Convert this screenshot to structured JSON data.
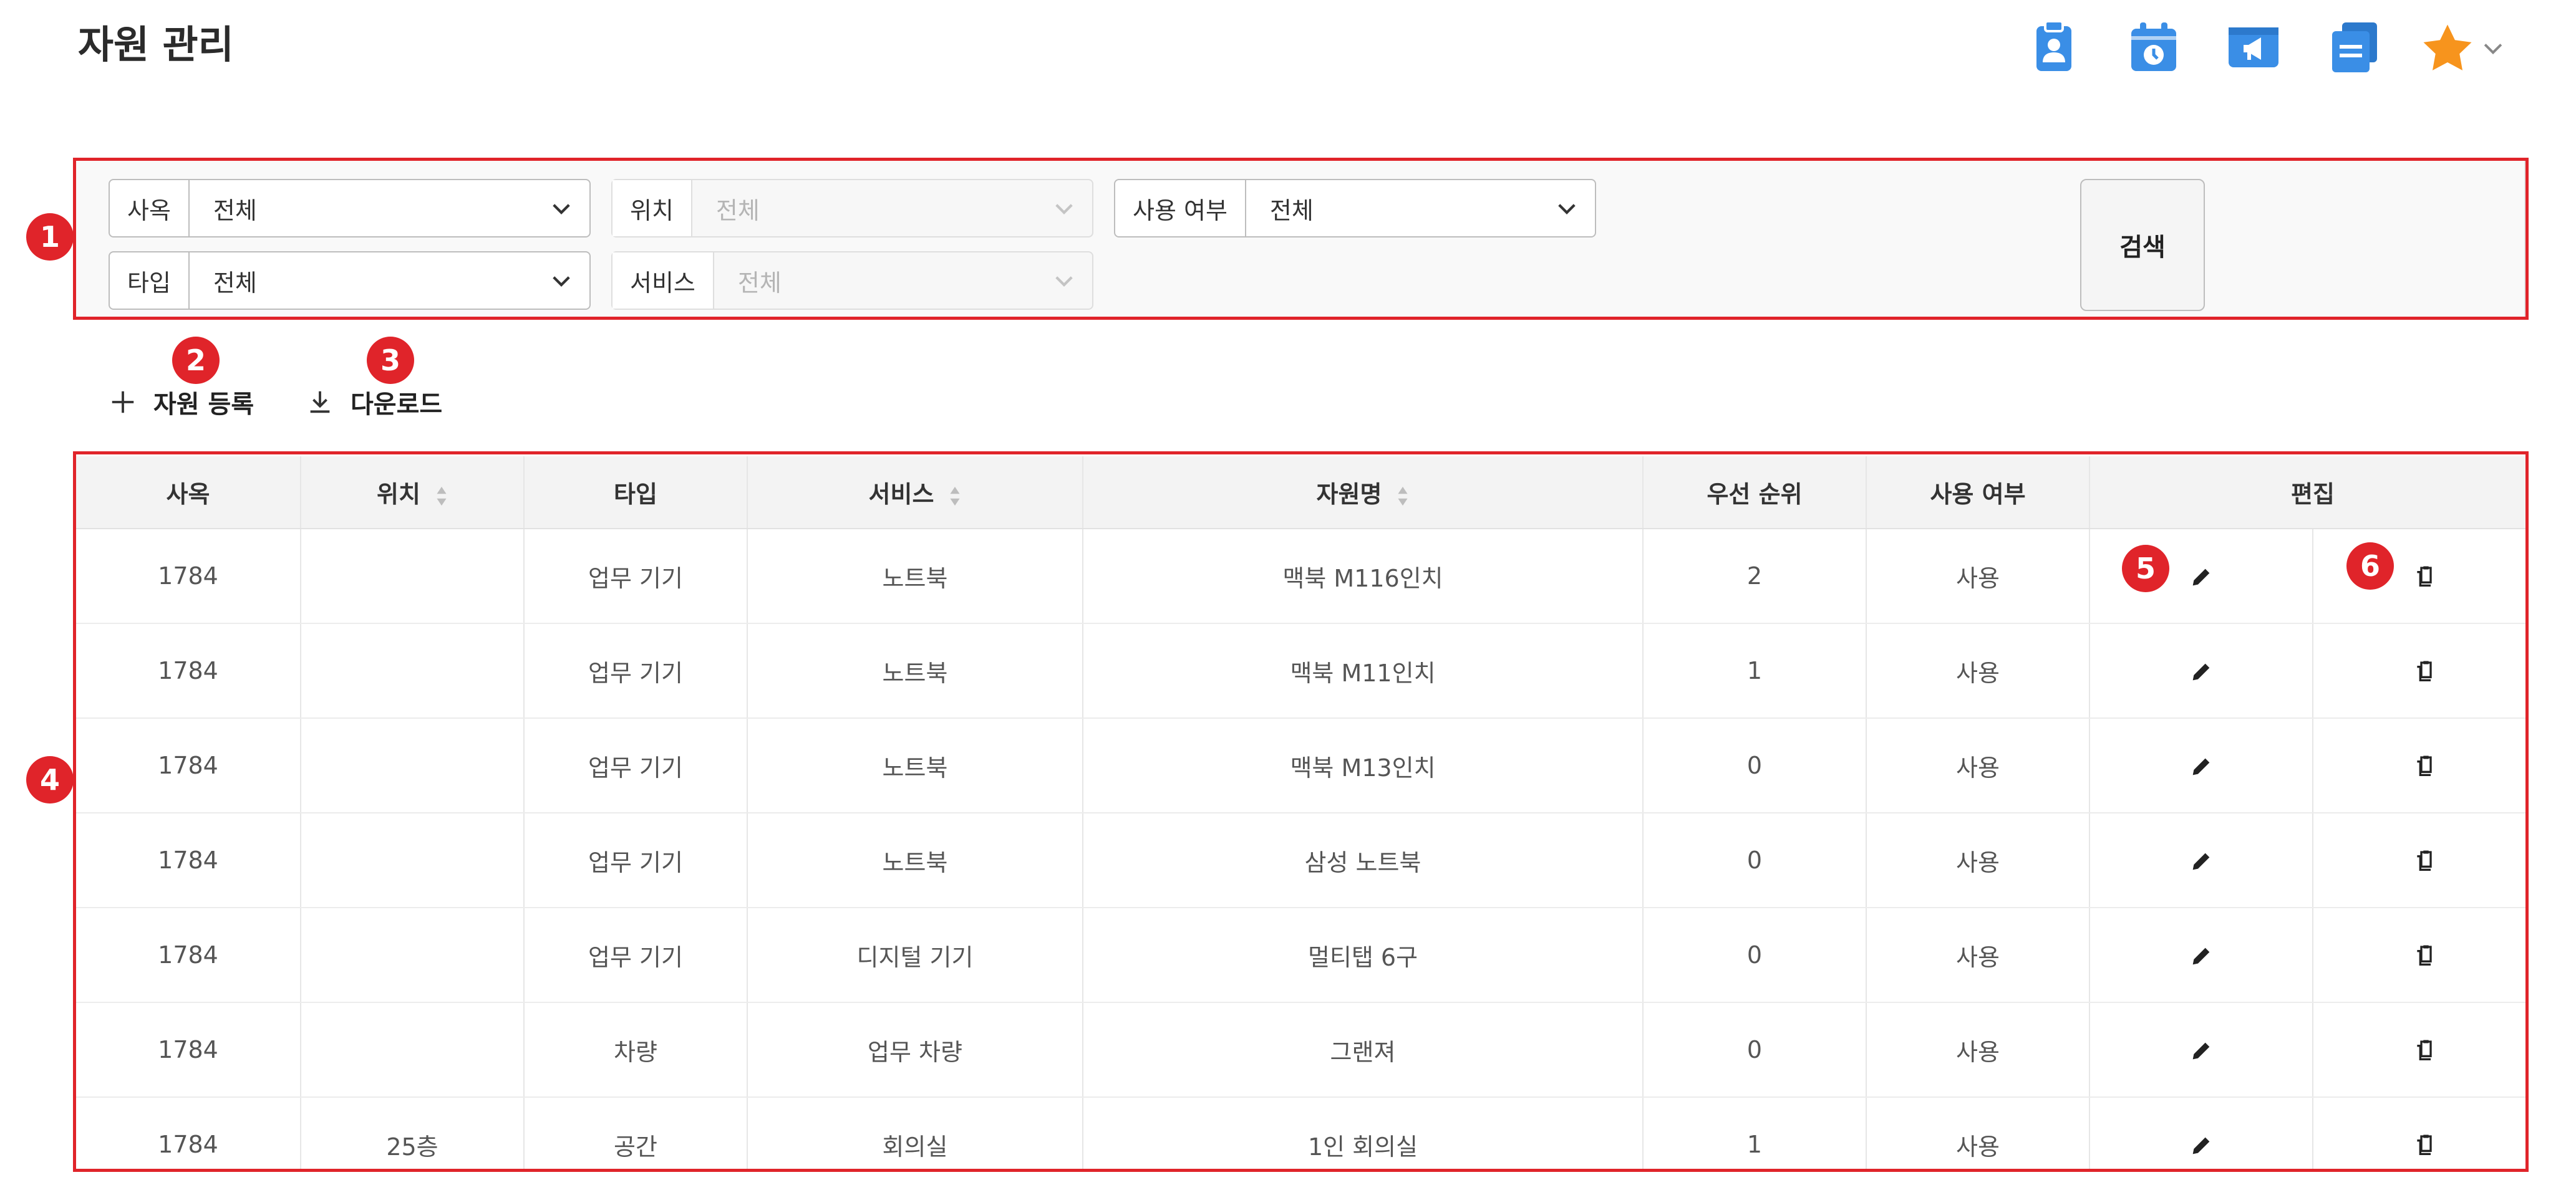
{
  "page": {
    "title": "자원 관리"
  },
  "header_icons": [
    "clipboard-user-icon",
    "calendar-clock-icon",
    "megaphone-window-icon",
    "stacked-documents-icon",
    "favorite-star-icon"
  ],
  "colors": {
    "icon_blue": "#3a8ee6",
    "star": "#f7941d",
    "callout_red": "#e0242a"
  },
  "filters": {
    "building": {
      "label": "사옥",
      "value": "전체"
    },
    "location": {
      "label": "위치",
      "value": "전체"
    },
    "usage": {
      "label": "사용 여부",
      "value": "전체"
    },
    "type": {
      "label": "타입",
      "value": "전체"
    },
    "service": {
      "label": "서비스",
      "value": "전체"
    },
    "search_label": "검색"
  },
  "actions": {
    "register_label": "자원 등록",
    "download_label": "다운로드"
  },
  "callouts": [
    "1",
    "2",
    "3",
    "4",
    "5",
    "6"
  ],
  "table": {
    "columns": [
      "사옥",
      "위치",
      "타입",
      "서비스",
      "자원명",
      "우선 순위",
      "사용 여부",
      "편집"
    ],
    "rows": [
      [
        "1784",
        "",
        "업무 기기",
        "노트북",
        "맥북 M116인치",
        "2",
        "사용"
      ],
      [
        "1784",
        "",
        "업무 기기",
        "노트북",
        "맥북 M11인치",
        "1",
        "사용"
      ],
      [
        "1784",
        "",
        "업무 기기",
        "노트북",
        "맥북 M13인치",
        "0",
        "사용"
      ],
      [
        "1784",
        "",
        "업무 기기",
        "노트북",
        "삼성 노트북",
        "0",
        "사용"
      ],
      [
        "1784",
        "",
        "업무 기기",
        "디지털 기기",
        "멀티탭 6구",
        "0",
        "사용"
      ],
      [
        "1784",
        "",
        "차량",
        "업무 차량",
        "그랜져",
        "0",
        "사용"
      ],
      [
        "1784",
        "25층",
        "공간",
        "회의실",
        "1인 회의실",
        "1",
        "사용"
      ]
    ]
  }
}
